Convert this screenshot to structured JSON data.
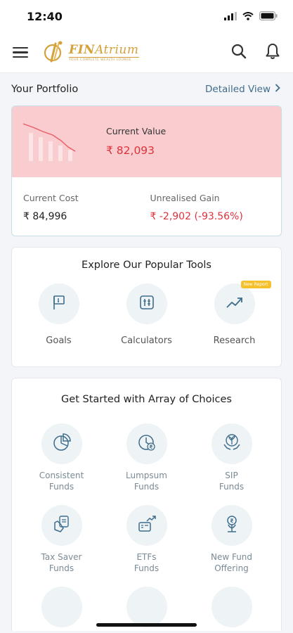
{
  "status_bar": {
    "time": "12:40"
  },
  "header": {
    "logo_main": "FIN",
    "logo_accent": "Atrium",
    "logo_tagline": "YOUR COMPLETE WEALTH LOUNGE"
  },
  "portfolio": {
    "title": "Your Portfolio",
    "detailed_view_label": "Detailed View",
    "current_value_label": "Current Value",
    "current_value": "₹ 82,093",
    "current_cost_label": "Current Cost",
    "current_cost": "₹ 84,996",
    "unrealised_gain_label": "Unrealised Gain",
    "unrealised_gain": "₹ -2,902 (-93.56%)"
  },
  "tools": {
    "title": "Explore Our Popular Tools",
    "items": [
      {
        "label": "Goals",
        "icon": "flag-icon"
      },
      {
        "label": "Calculators",
        "icon": "calculator-icon"
      },
      {
        "label": "Research",
        "icon": "trend-up-icon",
        "badge": "New Report"
      }
    ]
  },
  "choices": {
    "title": "Get Started with Array of Choices",
    "items": [
      {
        "label": "Consistent\nFunds",
        "icon": "pie-chart-icon"
      },
      {
        "label": "Lumpsum\nFunds",
        "icon": "clock-rupee-icon"
      },
      {
        "label": "SIP\nFunds",
        "icon": "hands-plant-icon"
      },
      {
        "label": "Tax Saver\nFunds",
        "icon": "tax-saver-icon"
      },
      {
        "label": "ETFs\nFunds",
        "icon": "etf-icon"
      },
      {
        "label": "New Fund\nOffering",
        "icon": "new-fund-icon"
      }
    ]
  },
  "colors": {
    "accent": "#3f6d8c",
    "loss_red": "#e0323c",
    "loss_bg": "#f9cccf",
    "brand_gold": "#d4a13a"
  }
}
